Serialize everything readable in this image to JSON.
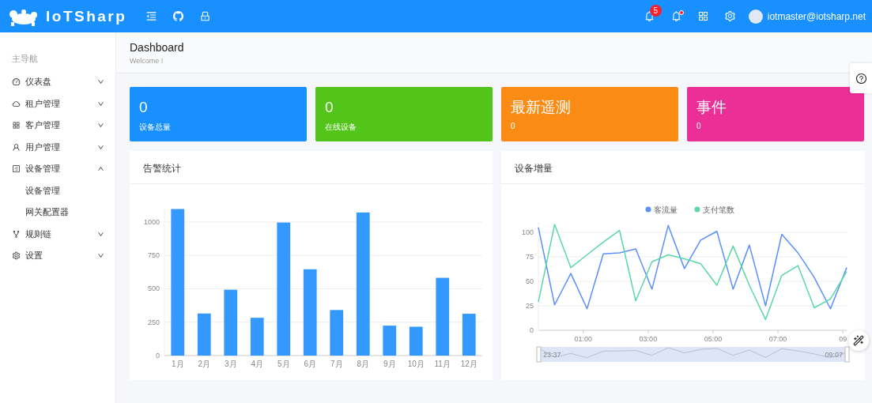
{
  "header": {
    "brand": "IoTSharp",
    "notification_count": "5",
    "unread_dot": true,
    "user": "iotmaster@iotsharp.net"
  },
  "sidebar": {
    "group_label": "主导航",
    "items": [
      {
        "label": "仪表盘",
        "expanded": false
      },
      {
        "label": "租户管理",
        "expanded": false
      },
      {
        "label": "客户管理",
        "expanded": false
      },
      {
        "label": "用户管理",
        "expanded": false
      },
      {
        "label": "设备管理",
        "expanded": true,
        "children": [
          {
            "label": "设备管理"
          },
          {
            "label": "网关配置器"
          }
        ]
      },
      {
        "label": "规则链",
        "expanded": false
      },
      {
        "label": "设置",
        "expanded": false
      }
    ]
  },
  "page_header": {
    "title": "Dashboard",
    "subtitle": "Welcome !"
  },
  "stat_cards": [
    {
      "big": "0",
      "small": "设备总量",
      "color": "#1890ff"
    },
    {
      "big": "0",
      "small": "在线设备",
      "color": "#52c41a"
    },
    {
      "big": "最新遥测",
      "small": "0",
      "color": "#fa8c16"
    },
    {
      "big": "事件",
      "small": "0",
      "color": "#eb2f96"
    }
  ],
  "alarm_card": {
    "title": "告警统计",
    "chart_data": {
      "type": "bar",
      "categories": [
        "1月",
        "2月",
        "3月",
        "4月",
        "5月",
        "6月",
        "7月",
        "8月",
        "9月",
        "10月",
        "11月",
        "12月"
      ],
      "series": [
        {
          "color": "#3399ff",
          "values": [
            1097,
            315,
            493,
            283,
            996,
            646,
            341,
            1071,
            224,
            216,
            582,
            313
          ]
        }
      ],
      "ylim": [
        0,
        1100
      ],
      "yticks": [
        0,
        250,
        500,
        750,
        1000
      ],
      "grid": true
    }
  },
  "growth_card": {
    "title": "设备增量",
    "chart_data": {
      "type": "line",
      "x": [
        -0.383,
        0.117,
        0.617,
        1.117,
        1.617,
        2.117,
        2.617,
        3.117,
        3.617,
        4.117,
        4.617,
        5.117,
        5.617,
        6.117,
        6.617,
        7.117,
        7.617,
        8.117,
        8.617,
        9.117
      ],
      "series": [
        {
          "name": "客流量",
          "color": "#5b8ff9",
          "values": [
            105,
            26,
            58,
            22,
            78,
            79,
            83,
            42,
            107,
            63,
            92,
            101,
            42,
            87,
            25,
            98,
            79,
            54,
            22,
            64
          ]
        },
        {
          "name": "支付笔数",
          "color": "#5ad8a6",
          "values": [
            29,
            108,
            64,
            77,
            90,
            102,
            30,
            70,
            77,
            73,
            68,
            46,
            86,
            46,
            11,
            56,
            66,
            23,
            32,
            60
          ]
        }
      ],
      "xlim": [
        -0.383,
        9.117
      ],
      "ylim": [
        0,
        110
      ],
      "yticks": [
        0,
        25,
        50,
        75,
        100
      ],
      "xticks": [
        {
          "value": 1,
          "label": "01:00"
        },
        {
          "value": 3,
          "label": "03:00"
        },
        {
          "value": 5,
          "label": "05:00"
        },
        {
          "value": 7,
          "label": "07:00"
        },
        {
          "value": 9,
          "label": "09"
        }
      ],
      "grid": true,
      "legend": true
    },
    "zoom_range": {
      "start_label": "23:37",
      "end_label": "09:07"
    }
  }
}
